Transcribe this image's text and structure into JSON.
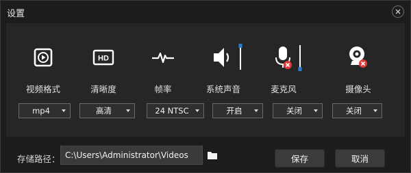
{
  "window": {
    "title": "设置"
  },
  "items": [
    {
      "label": "视频格式",
      "icon": "video-format-icon",
      "value": "mp4"
    },
    {
      "label": "清晰度",
      "icon": "hd-icon",
      "value": "高清"
    },
    {
      "label": "帧率",
      "icon": "frame-rate-icon",
      "value": "24 NTSC"
    },
    {
      "label": "系统声音",
      "icon": "speaker-icon",
      "value": "开启"
    },
    {
      "label": "麦克风",
      "icon": "microphone-disabled-icon",
      "value": "关闭"
    },
    {
      "label": "摄像头",
      "icon": "webcam-disabled-icon",
      "value": "关闭"
    }
  ],
  "storage": {
    "label": "存储路径：",
    "path": "C:\\Users\\Administrator\\Videos"
  },
  "buttons": {
    "save": "保存",
    "cancel": "取消"
  },
  "colors": {
    "accent": "#2c7cd4",
    "badge": "#e23a3a",
    "icon": "#ffffff"
  }
}
